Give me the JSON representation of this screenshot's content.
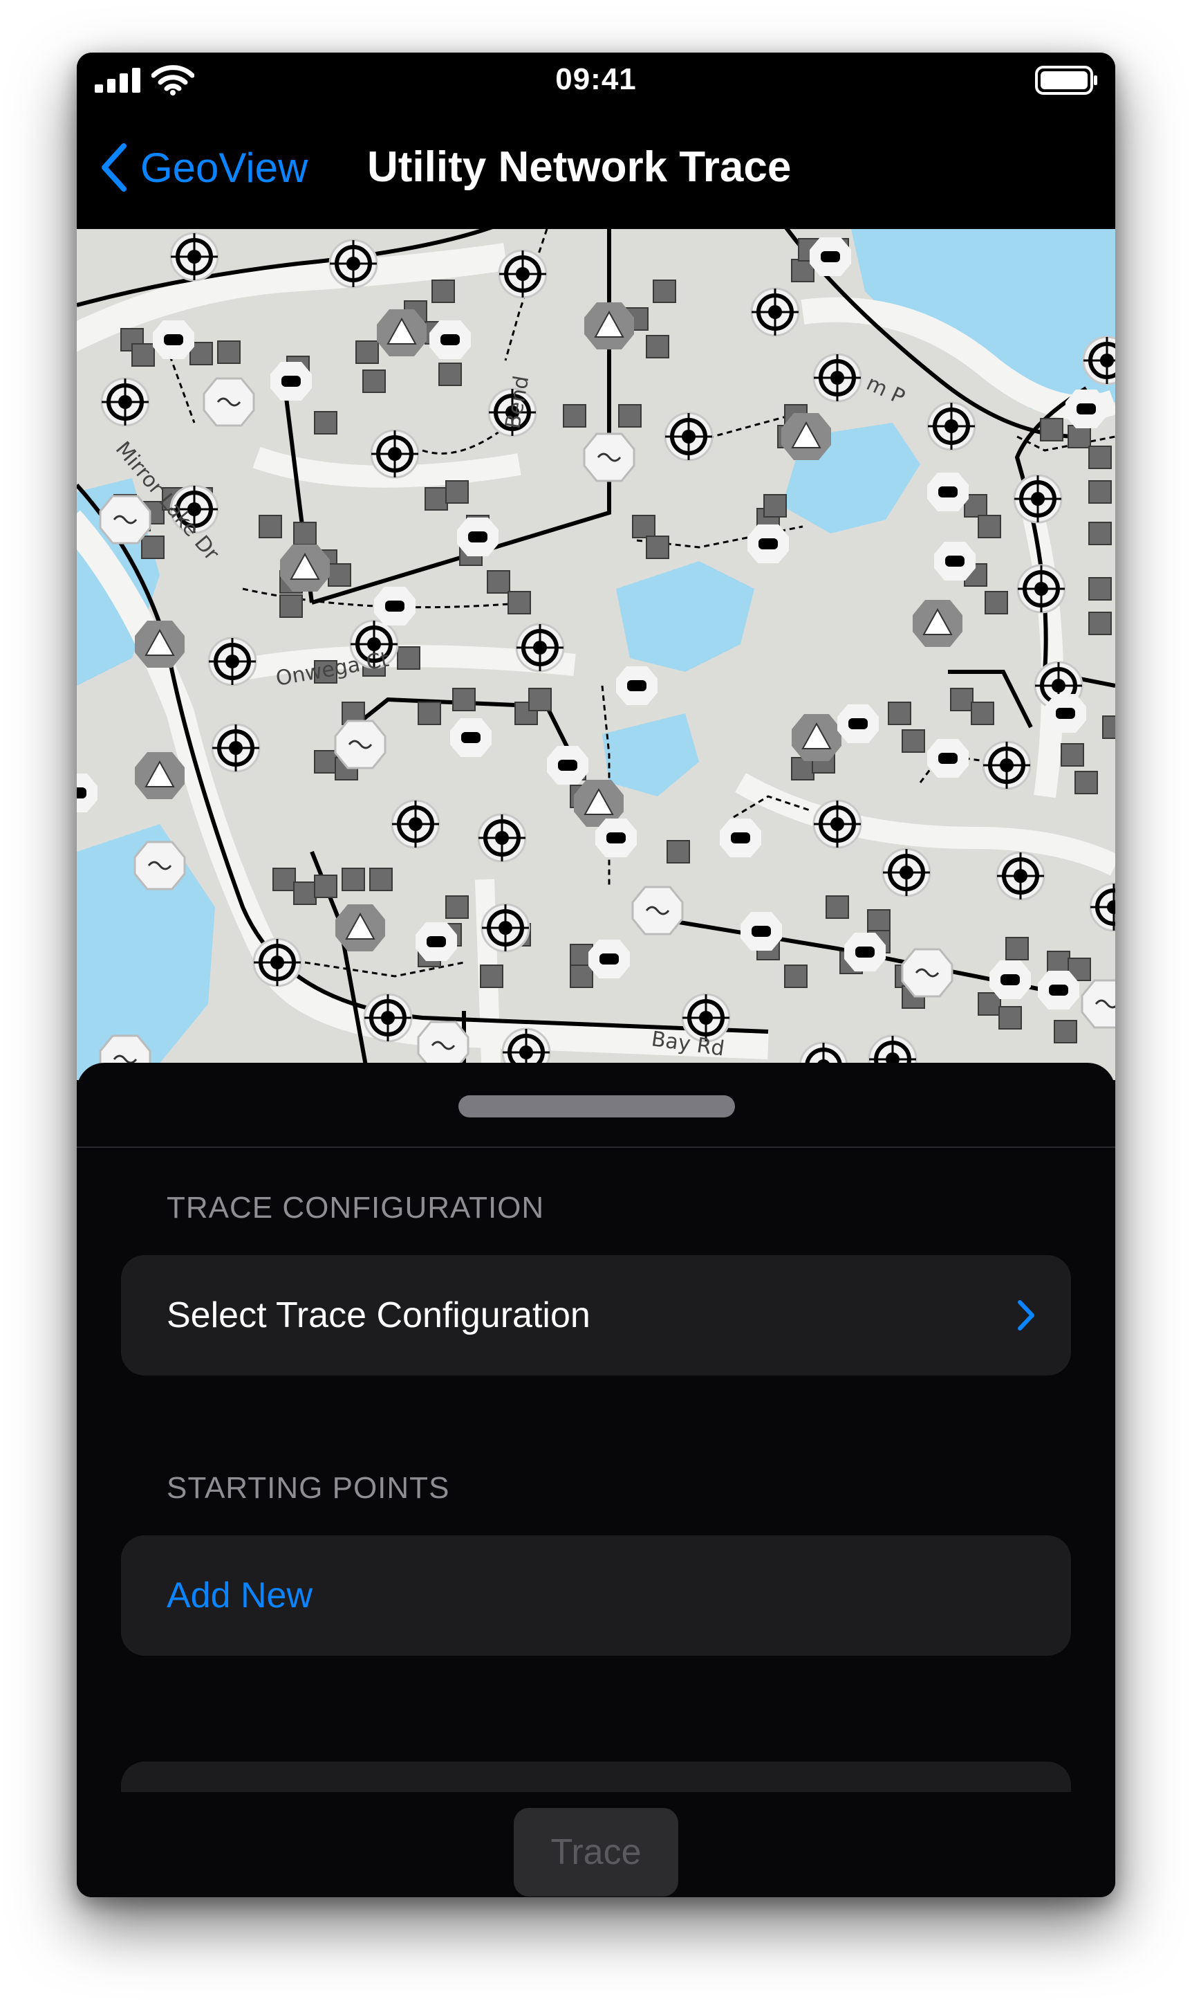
{
  "status_bar": {
    "time": "09:41",
    "icons": [
      "cellular-signal-icon",
      "wifi-icon",
      "battery-icon"
    ]
  },
  "nav": {
    "back_label": "GeoView",
    "title": "Utility Network Trace"
  },
  "map": {
    "street_labels": [
      "Mirror Lake Dr",
      "Bend",
      "Onwega Ct",
      "Bay Rd",
      "m P"
    ],
    "colors": {
      "land": "#dcdcd8",
      "water": "#9fd8f0",
      "road": "#f4f4f2",
      "line": "#000000"
    }
  },
  "sheet": {
    "trace_configuration": {
      "header": "TRACE CONFIGURATION",
      "select_label": "Select Trace Configuration"
    },
    "starting_points": {
      "header": "STARTING POINTS",
      "add_new_label": "Add New"
    },
    "trace_button_label": "Trace"
  },
  "colors": {
    "accent": "#0a84ff",
    "sheet_background": "#070709",
    "cell_background": "#1c1c1e",
    "section_header": "#8e8e93"
  }
}
